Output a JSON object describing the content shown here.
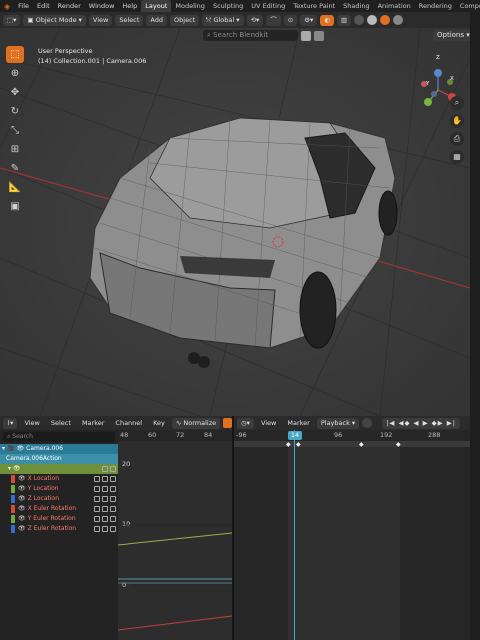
{
  "topbar": {
    "menus": [
      "File",
      "Edit",
      "Render",
      "Window",
      "Help"
    ],
    "workspaces": [
      "Layout",
      "Modeling",
      "Sculpting",
      "UV Editing",
      "Texture Paint",
      "Shading",
      "Animation",
      "Rendering",
      "Compos"
    ],
    "active_workspace": "Layout"
  },
  "viewport_header": {
    "mode": "Object Mode",
    "menus": [
      "View",
      "Select",
      "Add",
      "Object"
    ],
    "transform_orientation": "Global",
    "search_placeholder": "Search Blendkit",
    "options_label": "Options"
  },
  "viewport": {
    "view_name": "User Perspective",
    "collection_info": "(14) Collection.001 | Camera.006",
    "gizmo_axes": [
      "Z",
      "X",
      "Y"
    ]
  },
  "graph_editor": {
    "menus": [
      "View",
      "Select",
      "Marker",
      "Channel",
      "Key"
    ],
    "normalize_label": "Normalize",
    "search_placeholder": "Search",
    "ruler_frames": [
      "48",
      "60",
      "72",
      "84"
    ],
    "y_labels": [
      "20",
      "10",
      "0"
    ],
    "object": "Camera.006",
    "action": "Camera.006Action",
    "channels": [
      {
        "name": "X Location",
        "color": "#d84a3a"
      },
      {
        "name": "Y Location",
        "color": "#6cae3a"
      },
      {
        "name": "Z Location",
        "color": "#3a6ad8"
      },
      {
        "name": "X Euler Rotation",
        "color": "#d84a3a"
      },
      {
        "name": "Y Euler Rotation",
        "color": "#6cae3a"
      },
      {
        "name": "Z Euler Rotation",
        "color": "#3a6ad8"
      }
    ]
  },
  "dopesheet": {
    "menus": [
      "View",
      "Marker"
    ],
    "playback_label": "Playback",
    "ruler_frames": [
      "-96",
      "14",
      "96",
      "192",
      "288"
    ],
    "current_frame": "14"
  },
  "colors": {
    "accent": "#e07020",
    "playhead": "#4aa6c8",
    "channel_header": "#2a7a98"
  }
}
